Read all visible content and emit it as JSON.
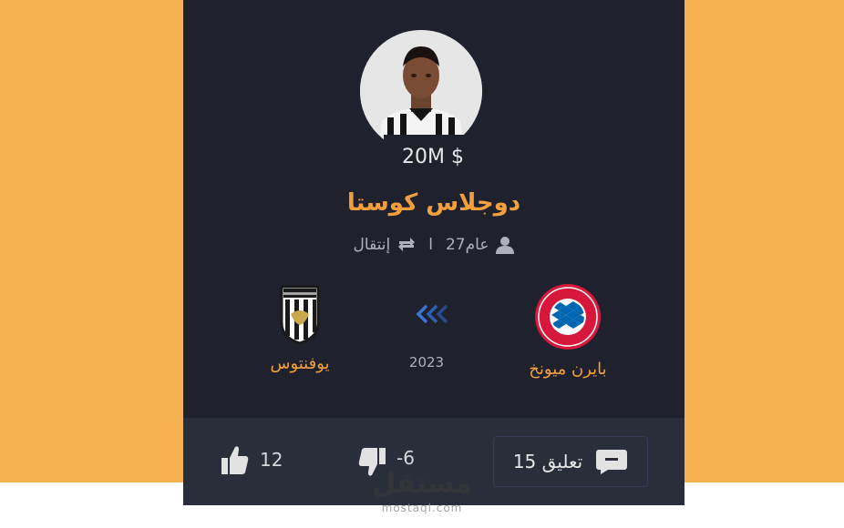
{
  "card": {
    "price": "20M $",
    "player_name": "دوجلاس كوستا",
    "meta": {
      "age": "عام27",
      "separator": "ا",
      "type": "إنتقال"
    },
    "from_club": {
      "name": "بايرن ميونخ",
      "logo_text": "FC BAYERN MÜNCHEN"
    },
    "to_club": {
      "name": "يوفنتوس",
      "logo_text": "JUVENTUS"
    },
    "year": "2023",
    "stats": {
      "likes": "12",
      "dislikes": "-6",
      "comments_label": "تعليق 15"
    }
  },
  "watermark": {
    "arabic": "مستقل",
    "latin": "mostaql.com"
  },
  "colors": {
    "background": "#f6b150",
    "card": "#1f212d",
    "accent": "#f2a03e",
    "arrow": "#3b74d8"
  }
}
